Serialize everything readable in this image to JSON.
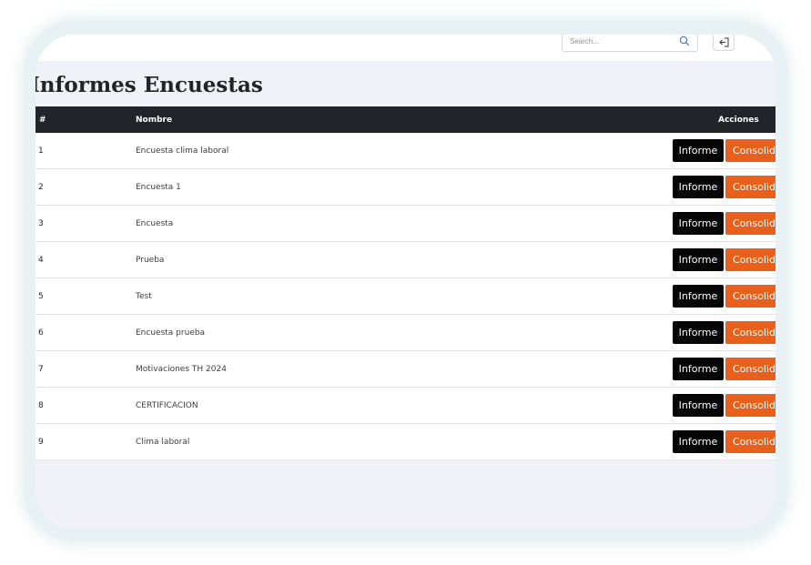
{
  "search": {
    "placeholder": "Search..."
  },
  "page": {
    "title": "Informes Encuestas"
  },
  "table": {
    "columns": [
      "#",
      "Nombre",
      "Acciones"
    ],
    "rows": [
      {
        "num": "1",
        "name": "Encuesta clima laboral"
      },
      {
        "num": "2",
        "name": "Encuesta 1"
      },
      {
        "num": "3",
        "name": "Encuesta"
      },
      {
        "num": "4",
        "name": "Prueba"
      },
      {
        "num": "5",
        "name": "Test"
      },
      {
        "num": "6",
        "name": "Encuesta prueba"
      },
      {
        "num": "7",
        "name": "Motivaciones TH 2024"
      },
      {
        "num": "8",
        "name": "CERTIFICACION"
      },
      {
        "num": "9",
        "name": "Clima laboral"
      }
    ],
    "actions": {
      "informe_label": "Informe",
      "consolidado_label": "Consolida"
    }
  },
  "colors": {
    "header_bg": "#212529",
    "informe_btn": "#050505",
    "consolidado_btn": "#e8601c",
    "page_bg": "#f0f2f8"
  },
  "icons": {
    "search": "search-icon",
    "logout": "logout-icon"
  }
}
